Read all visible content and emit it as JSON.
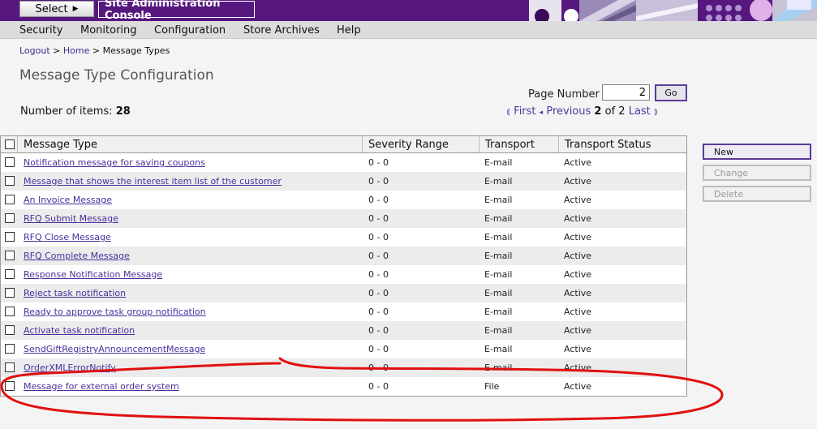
{
  "banner": {
    "select_label": "Select",
    "app_title": "Site Administration Console",
    "brand_color": "#56187f"
  },
  "menu": {
    "items": [
      "Security",
      "Monitoring",
      "Configuration",
      "Store Archives",
      "Help"
    ]
  },
  "breadcrumb": {
    "logout": "Logout",
    "sep1": ">",
    "home": "Home",
    "sep2": ">",
    "current": "Message Types"
  },
  "page": {
    "title": "Message Type Configuration",
    "items_label": "Number of items:",
    "items_count": "28"
  },
  "pagination": {
    "page_number_label": "Page Number",
    "page_number_value": "2",
    "go_label": "Go",
    "first_label": "First",
    "previous_label": "Previous",
    "current_page": "2",
    "of_label": "of",
    "total_pages": "2",
    "last_label": "Last"
  },
  "table": {
    "columns": [
      "Message Type",
      "Severity Range",
      "Transport",
      "Transport Status"
    ],
    "rows": [
      {
        "type": "Notification message for saving coupons",
        "severity": "0 - 0",
        "transport": "E-mail",
        "status": "Active"
      },
      {
        "type": "Message that shows the interest item list of the customer",
        "severity": "0 - 0",
        "transport": "E-mail",
        "status": "Active"
      },
      {
        "type": "An Invoice Message",
        "severity": "0 - 0",
        "transport": "E-mail",
        "status": "Active"
      },
      {
        "type": "RFQ Submit Message",
        "severity": "0 - 0",
        "transport": "E-mail",
        "status": "Active"
      },
      {
        "type": "RFQ Close Message",
        "severity": "0 - 0",
        "transport": "E-mail",
        "status": "Active"
      },
      {
        "type": "RFQ Complete Message",
        "severity": "0 - 0",
        "transport": "E-mail",
        "status": "Active"
      },
      {
        "type": "Response Notification Message",
        "severity": "0 - 0",
        "transport": "E-mail",
        "status": "Active"
      },
      {
        "type": "Reject task notification",
        "severity": "0 - 0",
        "transport": "E-mail",
        "status": "Active"
      },
      {
        "type": "Ready to approve task group notification",
        "severity": "0 - 0",
        "transport": "E-mail",
        "status": "Active"
      },
      {
        "type": "Activate task notification",
        "severity": "0 - 0",
        "transport": "E-mail",
        "status": "Active"
      },
      {
        "type": "SendGiftRegistryAnnouncementMessage",
        "severity": "0 - 0",
        "transport": "E-mail",
        "status": "Active"
      },
      {
        "type": "OrderXMLErrorNotify",
        "severity": "0 - 0",
        "transport": "E-mail",
        "status": "Active"
      },
      {
        "type": "Message for external order system",
        "severity": "0 - 0",
        "transport": "File",
        "status": "Active"
      }
    ]
  },
  "actions": {
    "new_label": "New",
    "change_label": "Change",
    "delete_label": "Delete"
  },
  "annotation": {
    "color": "#e01010",
    "note": "hand-drawn red outline around the last row"
  }
}
